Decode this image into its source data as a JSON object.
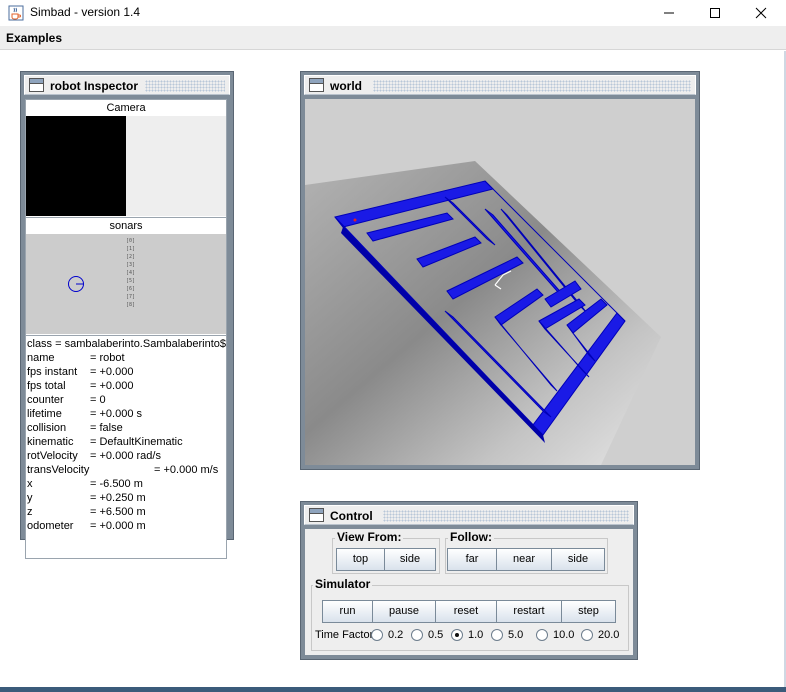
{
  "window": {
    "title": "Simbad  - version 1.4"
  },
  "menu": {
    "items": [
      "Examples"
    ]
  },
  "inspector": {
    "title": "robot Inspector",
    "camera_label": "Camera",
    "sonars_label": "sonars",
    "sonar_channels": [
      "[0]",
      "[1]",
      "[2]",
      "[3]",
      "[4]",
      "[5]",
      "[6]",
      "[7]",
      "[8]"
    ],
    "properties": [
      {
        "key": "class = sambalaberinto.Sambalaberinto$R",
        "value": ""
      },
      {
        "key": "name",
        "value": "= robot"
      },
      {
        "key": "fps instant",
        "value": "= +0.000"
      },
      {
        "key": "fps total",
        "value": "= +0.000"
      },
      {
        "key": "counter",
        "value": "= 0"
      },
      {
        "key": "lifetime",
        "value": "= +0.000 s"
      },
      {
        "key": "collision",
        "value": "= false"
      },
      {
        "key": "kinematic",
        "value": "= DefaultKinematic"
      },
      {
        "key": "rotVelocity",
        "value": "= +0.000 rad/s"
      },
      {
        "key": "transVelocity",
        "value": "= +0.000 m/s"
      },
      {
        "key": "x",
        "value": "= -6.500 m"
      },
      {
        "key": "y",
        "value": "= +0.250 m"
      },
      {
        "key": "z",
        "value": "= +6.500 m"
      },
      {
        "key": "odometer",
        "value": "= +0.000 m"
      }
    ]
  },
  "world": {
    "title": "world"
  },
  "control": {
    "title": "Control",
    "view_from": {
      "label": "View From:",
      "buttons": [
        "top",
        "side"
      ]
    },
    "follow": {
      "label": "Follow:",
      "buttons": [
        "far",
        "near",
        "side"
      ]
    },
    "simulator": {
      "label": "Simulator",
      "buttons": [
        "run",
        "pause",
        "reset",
        "restart",
        "step"
      ],
      "time_factor_label": "Time Factor",
      "time_factors": [
        "0.2",
        "0.5",
        "1.0",
        "5.0",
        "10.0",
        "20.0"
      ],
      "selected_time_factor": "1.0"
    }
  },
  "colors": {
    "frame_border": "#7e8b98",
    "maze_blue": "#1010e6",
    "panel_bg": "#eeeeee"
  }
}
